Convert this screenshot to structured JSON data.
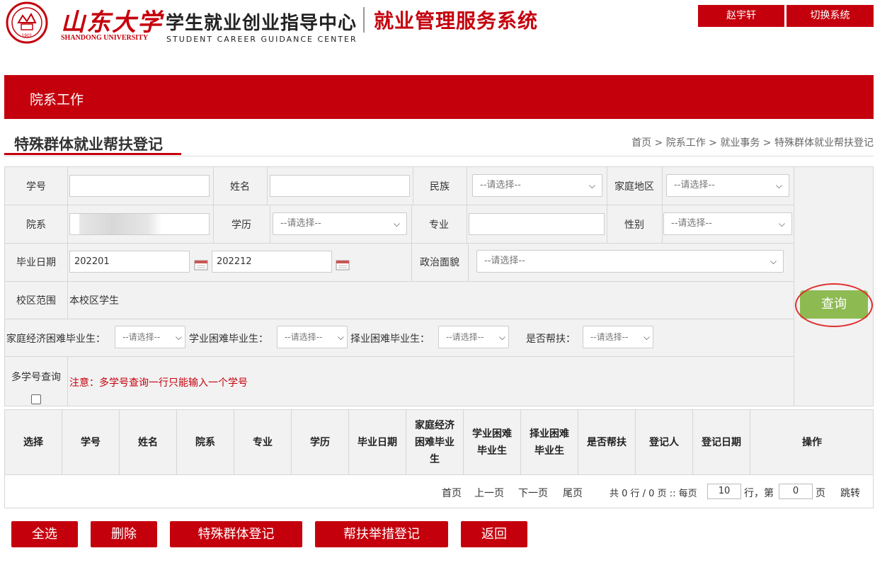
{
  "header": {
    "brand_cn": "山东大学",
    "brand_en": "SHANDONG UNIVERSITY",
    "seal_year": "1901",
    "center_cn": "学生就业创业指导中心",
    "center_en": "STUDENT   CAREER   GUIDANCE   CENTER",
    "system_title": "就业管理服务系统",
    "user_button": "赵宇轩",
    "switch_button": "切换系统"
  },
  "nav": {
    "section": "院系工作"
  },
  "page": {
    "title": "特殊群体就业帮扶登记",
    "breadcrumb": "首页 > 院系工作 > 就业事务 > 特殊群体就业帮扶登记"
  },
  "form": {
    "student_id_label": "学号",
    "name_label": "姓名",
    "ethnicity_label": "民族",
    "ethnicity_value": "--请选择--",
    "home_region_label": "家庭地区",
    "home_region_value": "--请选择--",
    "dept_label": "院系",
    "education_label": "学历",
    "education_value": "--请选择--",
    "major_label": "专业",
    "gender_label": "性别",
    "gender_value": "--请选择--",
    "grad_date_label": "毕业日期",
    "grad_date_from": "202201",
    "grad_date_to": "202212",
    "political_label": "政治面貌",
    "political_value": "--请选择--",
    "campus_label": "校区范围",
    "campus_value": "本校区学生",
    "econ_label": "家庭经济困难毕业生：",
    "econ_value": "--请选择--",
    "study_label": "学业困难毕业生：",
    "study_value": "--请选择--",
    "job_label": "择业困难毕业生：",
    "job_value": "--请选择--",
    "assisted_label": "是否帮扶：",
    "assisted_value": "--请选择--",
    "multi_id_label": "多学号查询",
    "multi_id_note": "注意：多学号查询一行只能输入一个学号",
    "query_button": "查询"
  },
  "table": {
    "columns": [
      "选择",
      "学号",
      "姓名",
      "院系",
      "专业",
      "学历",
      "毕业日期",
      "家庭经济困难毕业生",
      "学业困难毕业生",
      "择业困难毕业生",
      "是否帮扶",
      "登记人",
      "登记日期",
      "操作"
    ],
    "col_lines": [
      [
        "选择"
      ],
      [
        "学号"
      ],
      [
        "姓名"
      ],
      [
        "院系"
      ],
      [
        "专业"
      ],
      [
        "学历"
      ],
      [
        "毕业日期"
      ],
      [
        "家庭经济",
        "困难毕业",
        "生"
      ],
      [
        "学业困难",
        "毕业生"
      ],
      [
        "择业困难",
        "毕业生"
      ],
      [
        "是否帮扶"
      ],
      [
        "登记人"
      ],
      [
        "登记日期"
      ],
      [
        "操作"
      ]
    ]
  },
  "pager": {
    "first": "首页",
    "prev": "上一页",
    "next": "下一页",
    "last": "尾页",
    "summary": "共 0 行 / 0 页 :: 每页",
    "per_page": "10",
    "rows_label": "行，第",
    "page_no": "0",
    "page_suffix": "页",
    "jump": "跳转"
  },
  "actions": {
    "select_all": "全选",
    "delete": "删除",
    "special_register": "特殊群体登记",
    "assist_register": "帮扶举措登记",
    "back": "返回"
  },
  "colors": {
    "primary_red": "#c5000d",
    "query_green": "#8dbb52",
    "highlight_ring": "#e0302e"
  }
}
